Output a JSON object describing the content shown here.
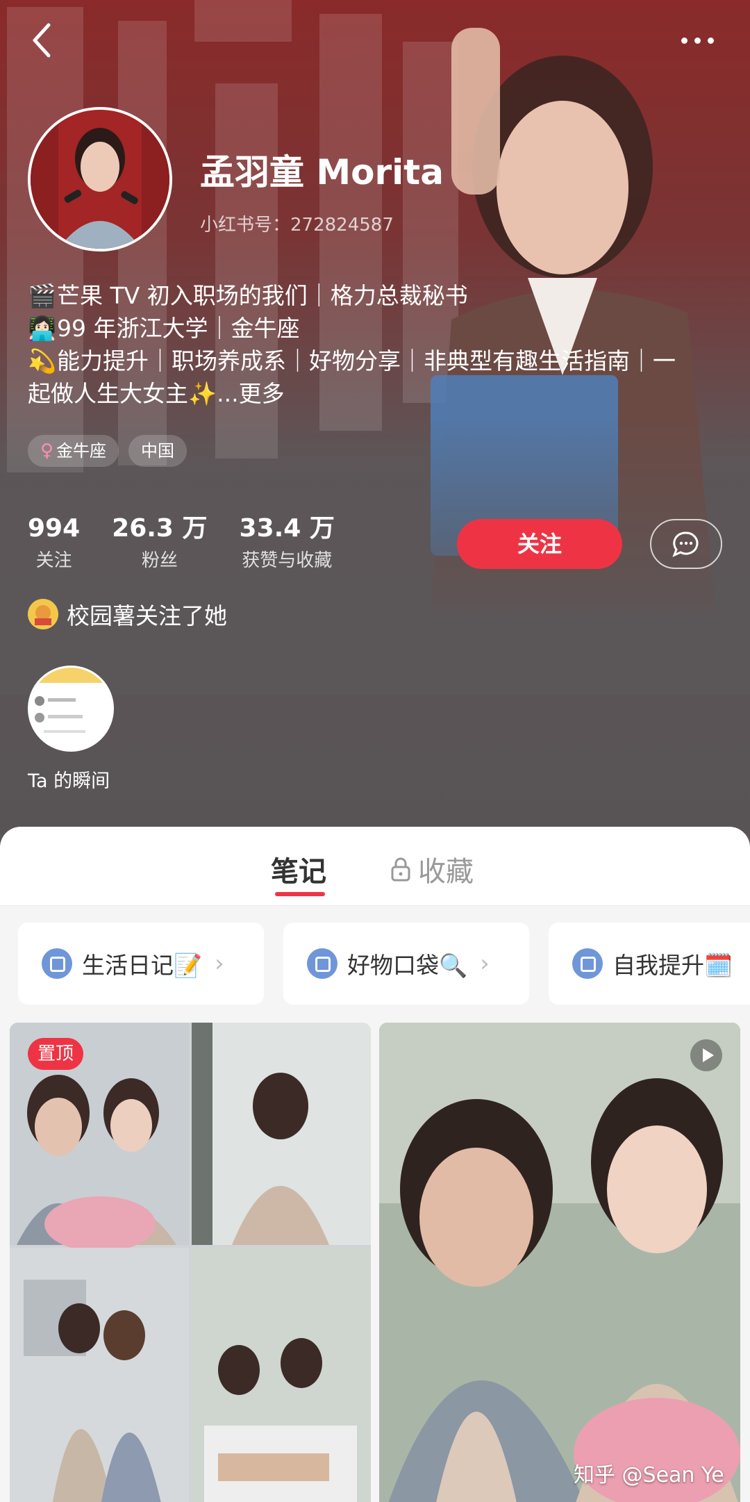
{
  "header": {
    "back_icon": "chevron-left-icon",
    "more_icon": "more-dots-icon"
  },
  "profile": {
    "nickname": "孟羽童 Morita",
    "red_id_label": "小红书号：",
    "red_id": "272824587",
    "bio": [
      {
        "emoji": "🎬",
        "text": "芒果 TV 初入职场的我们｜格力总裁秘书"
      },
      {
        "emoji": "👩🏻‍💻",
        "text": "99 年浙江大学｜金牛座"
      },
      {
        "emoji": "💫",
        "text": "能力提升｜职场养成系｜好物分享｜非典型有趣生活指南｜一"
      },
      {
        "emoji": "",
        "text": "起做人生大女主✨"
      }
    ],
    "bio_more": "...更多",
    "tags": [
      {
        "icon": "female-icon",
        "symbol": "♀",
        "label": "金牛座"
      },
      {
        "icon": "",
        "symbol": "",
        "label": "中国"
      }
    ],
    "stats": [
      {
        "value": "994",
        "label": "关注"
      },
      {
        "value": "26.3 万",
        "label": "粉丝"
      },
      {
        "value": "33.4 万",
        "label": "获赞与收藏"
      }
    ],
    "follow_label": "关注",
    "message_icon": "chat-bubble-icon",
    "followed_by_text": "校园薯关注了她",
    "moments_label": "Ta 的瞬间"
  },
  "tabs": [
    {
      "label": "笔记",
      "active": true
    },
    {
      "label": "收藏",
      "active": false,
      "icon": "lock-icon"
    }
  ],
  "albums": [
    {
      "label": "生活日记📝"
    },
    {
      "label": "好物口袋🔍"
    },
    {
      "label": "自我提升🗓️"
    }
  ],
  "feed": {
    "pin_label": "置顶",
    "video_icon": "play-icon"
  },
  "watermark": "知乎 @Sean Ye",
  "colors": {
    "accent": "#ee3444",
    "hero_bg": "#5b5759",
    "panel_bg": "#f5f5f5"
  }
}
